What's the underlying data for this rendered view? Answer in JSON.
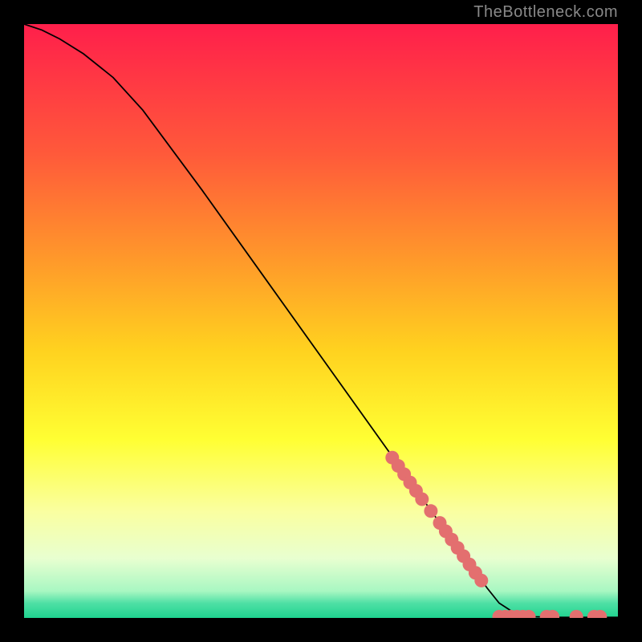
{
  "watermark": "TheBottleneck.com",
  "chart_data": {
    "type": "line",
    "title": "",
    "xlabel": "",
    "ylabel": "",
    "xlim": [
      0,
      100
    ],
    "ylim": [
      0,
      100
    ],
    "curve": [
      {
        "x": 0,
        "y": 100
      },
      {
        "x": 3,
        "y": 99
      },
      {
        "x": 6,
        "y": 97.5
      },
      {
        "x": 10,
        "y": 95
      },
      {
        "x": 15,
        "y": 91
      },
      {
        "x": 20,
        "y": 85.5
      },
      {
        "x": 30,
        "y": 72
      },
      {
        "x": 40,
        "y": 58
      },
      {
        "x": 50,
        "y": 44
      },
      {
        "x": 60,
        "y": 30
      },
      {
        "x": 70,
        "y": 16
      },
      {
        "x": 78,
        "y": 5
      },
      {
        "x": 80,
        "y": 2.5
      },
      {
        "x": 82,
        "y": 1.2
      },
      {
        "x": 84,
        "y": 0.5
      },
      {
        "x": 86,
        "y": 0.2
      },
      {
        "x": 90,
        "y": 0.1
      },
      {
        "x": 100,
        "y": 0.1
      }
    ],
    "markers": [
      {
        "x": 62,
        "y": 27
      },
      {
        "x": 63,
        "y": 25.6
      },
      {
        "x": 64,
        "y": 24.2
      },
      {
        "x": 65,
        "y": 22.8
      },
      {
        "x": 66,
        "y": 21.4
      },
      {
        "x": 67,
        "y": 20
      },
      {
        "x": 68.5,
        "y": 18
      },
      {
        "x": 70,
        "y": 16
      },
      {
        "x": 71,
        "y": 14.6
      },
      {
        "x": 72,
        "y": 13.2
      },
      {
        "x": 73,
        "y": 11.8
      },
      {
        "x": 74,
        "y": 10.4
      },
      {
        "x": 75,
        "y": 9
      },
      {
        "x": 76,
        "y": 7.6
      },
      {
        "x": 77,
        "y": 6.3
      },
      {
        "x": 80,
        "y": 0.2
      },
      {
        "x": 81,
        "y": 0.2
      },
      {
        "x": 82,
        "y": 0.2
      },
      {
        "x": 83,
        "y": 0.2
      },
      {
        "x": 84,
        "y": 0.2
      },
      {
        "x": 85,
        "y": 0.2
      },
      {
        "x": 88,
        "y": 0.2
      },
      {
        "x": 89,
        "y": 0.2
      },
      {
        "x": 93,
        "y": 0.2
      },
      {
        "x": 96,
        "y": 0.2
      },
      {
        "x": 97,
        "y": 0.2
      }
    ],
    "marker_color": "#e36f6f",
    "curve_color": "#000000",
    "background_gradient": [
      {
        "stop": 0.0,
        "color": "#ff1f4b"
      },
      {
        "stop": 0.22,
        "color": "#ff5a3a"
      },
      {
        "stop": 0.4,
        "color": "#ff9a2a"
      },
      {
        "stop": 0.55,
        "color": "#ffd21f"
      },
      {
        "stop": 0.7,
        "color": "#ffff33"
      },
      {
        "stop": 0.82,
        "color": "#faffa0"
      },
      {
        "stop": 0.9,
        "color": "#e8ffd0"
      },
      {
        "stop": 0.955,
        "color": "#a8f7c2"
      },
      {
        "stop": 0.975,
        "color": "#4fe0a5"
      },
      {
        "stop": 1.0,
        "color": "#1fd38f"
      }
    ]
  }
}
